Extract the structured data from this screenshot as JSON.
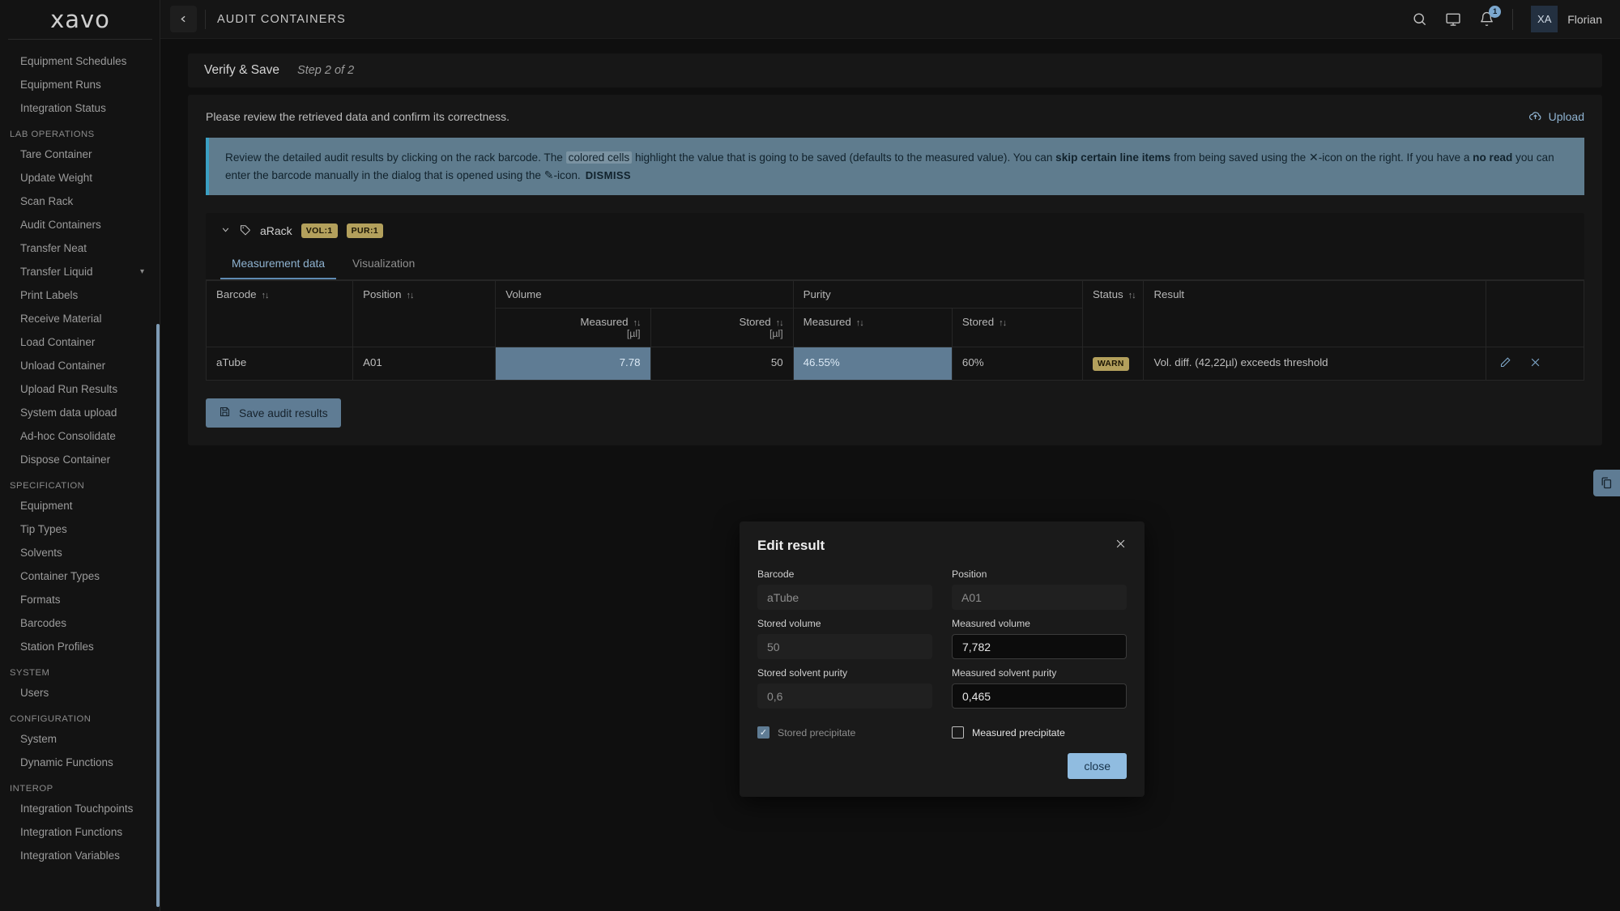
{
  "brand": {
    "logo": "xavo"
  },
  "sidebar": {
    "scroll_visible": true,
    "items": [
      {
        "label": "Equipment Schedules",
        "type": "item"
      },
      {
        "label": "Equipment Runs",
        "type": "item"
      },
      {
        "label": "Integration Status",
        "type": "item"
      },
      {
        "label": "LAB OPERATIONS",
        "type": "section"
      },
      {
        "label": "Tare Container",
        "type": "item"
      },
      {
        "label": "Update Weight",
        "type": "item"
      },
      {
        "label": "Scan Rack",
        "type": "item"
      },
      {
        "label": "Audit Containers",
        "type": "item"
      },
      {
        "label": "Transfer Neat",
        "type": "item"
      },
      {
        "label": "Transfer Liquid",
        "type": "item",
        "expandable": true
      },
      {
        "label": "Print Labels",
        "type": "item"
      },
      {
        "label": "Receive Material",
        "type": "item"
      },
      {
        "label": "Load Container",
        "type": "item"
      },
      {
        "label": "Unload Container",
        "type": "item"
      },
      {
        "label": "Upload Run Results",
        "type": "item"
      },
      {
        "label": "System data upload",
        "type": "item"
      },
      {
        "label": "Ad-hoc Consolidate",
        "type": "item"
      },
      {
        "label": "Dispose Container",
        "type": "item"
      },
      {
        "label": "SPECIFICATION",
        "type": "section"
      },
      {
        "label": "Equipment",
        "type": "item"
      },
      {
        "label": "Tip Types",
        "type": "item"
      },
      {
        "label": "Solvents",
        "type": "item"
      },
      {
        "label": "Container Types",
        "type": "item"
      },
      {
        "label": "Formats",
        "type": "item"
      },
      {
        "label": "Barcodes",
        "type": "item"
      },
      {
        "label": "Station Profiles",
        "type": "item"
      },
      {
        "label": "SYSTEM",
        "type": "section"
      },
      {
        "label": "Users",
        "type": "item"
      },
      {
        "label": "CONFIGURATION",
        "type": "section"
      },
      {
        "label": "System",
        "type": "item"
      },
      {
        "label": "Dynamic Functions",
        "type": "item"
      },
      {
        "label": "INTEROP",
        "type": "section"
      },
      {
        "label": "Integration Touchpoints",
        "type": "item"
      },
      {
        "label": "Integration Functions",
        "type": "item"
      },
      {
        "label": "Integration Variables",
        "type": "item"
      }
    ]
  },
  "topbar": {
    "back_icon": "chevron-left-icon",
    "title": "AUDIT CONTAINERS",
    "icons": [
      "search-icon",
      "monitor-icon",
      "bell-icon"
    ],
    "notification_count": "1",
    "avatar_initials": "XA",
    "username": "Florian"
  },
  "step": {
    "title": "Verify & Save",
    "subtitle": "Step 2 of 2"
  },
  "body": {
    "review_text": "Please review the retrieved data and confirm its correctness.",
    "upload_label": "Upload"
  },
  "banner": {
    "p1": "Review the detailed audit results by clicking on the rack barcode. The ",
    "highlight": "colored cells",
    "p2": " highlight the value that is going to be saved (defaults to the measured value). You can ",
    "b1": "skip certain line items",
    "p3": " from being saved using the ",
    "x_icon": "✕",
    "p4": "-icon on the right. If you have a ",
    "b2": "no read",
    "p5": " you can enter the barcode manually in the dialog that is opened using the ",
    "pencil_icon": "✎",
    "p6": "-icon.",
    "dismiss": "DISMISS"
  },
  "rack": {
    "name": "aRack",
    "tag_icon": "tag-icon",
    "chips": [
      "VOL:1",
      "PUR:1"
    ],
    "tabs": [
      {
        "label": "Measurement data",
        "active": true
      },
      {
        "label": "Visualization",
        "active": false
      }
    ]
  },
  "table": {
    "group_headers": [
      {
        "label": "Barcode",
        "sort": true
      },
      {
        "label": "Position",
        "sort": true
      },
      {
        "label": "Volume",
        "sort": false
      },
      {
        "label": "Purity",
        "sort": false
      },
      {
        "label": "Status",
        "sort": true
      },
      {
        "label": "Result",
        "sort": false
      }
    ],
    "sub_headers": {
      "volume_measured": "Measured",
      "volume_measured_unit": "[µl]",
      "volume_stored": "Stored",
      "volume_stored_unit": "[µl]",
      "purity_measured": "Measured",
      "purity_stored": "Stored"
    },
    "rows": [
      {
        "barcode": "aTube",
        "position": "A01",
        "volume_measured": "7.78",
        "volume_stored": "50",
        "purity_measured": "46.55%",
        "purity_stored": "60%",
        "status": "WARN",
        "result": "Vol. diff. (42,22µl) exceeds threshold",
        "actions": [
          "pencil-icon",
          "close-icon"
        ]
      }
    ]
  },
  "actions": {
    "save_label": "Save audit results",
    "save_icon": "floppy-disk-icon",
    "float_icon": "copy-documents-icon"
  },
  "modal": {
    "title": "Edit result",
    "close_icon": "close-icon",
    "fields": {
      "barcode_label": "Barcode",
      "barcode_value": "aTube",
      "position_label": "Position",
      "position_value": "A01",
      "stored_volume_label": "Stored volume",
      "stored_volume_value": "50",
      "measured_volume_label": "Measured volume",
      "measured_volume_value": "7,782",
      "stored_purity_label": "Stored solvent purity",
      "stored_purity_value": "0,6",
      "measured_purity_label": "Measured solvent purity",
      "measured_purity_value": "0,465"
    },
    "stored_precipitate_label": "Stored precipitate",
    "stored_precipitate_checked": true,
    "measured_precipitate_label": "Measured precipitate",
    "measured_precipitate_checked": false,
    "close_button": "close"
  },
  "colors": {
    "accent_blue": "#5f7c94",
    "highlight_cell": "#5f7c94",
    "banner_bg": "#5f7c8e",
    "banner_border": "#3aa0c4",
    "chip_gold": "#b3a05c",
    "link_blue": "#8fb3d1",
    "button_light_blue": "#90bce0",
    "sidebar_bg": "#131313",
    "page_bg": "#0f0f0f"
  }
}
